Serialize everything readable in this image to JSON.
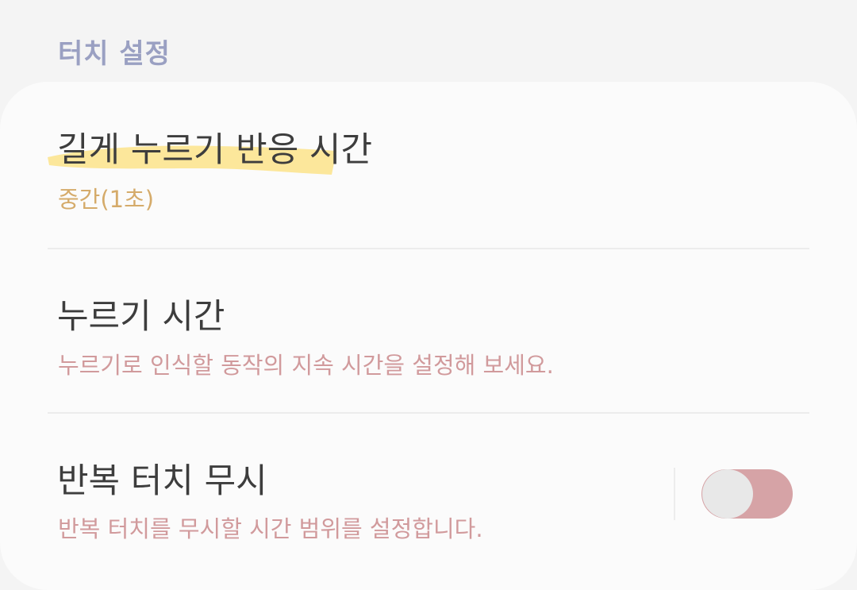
{
  "section": {
    "title": "터치 설정"
  },
  "items": [
    {
      "title": "길게 누르기 반응 시간",
      "subtitle": "중간(1초)"
    },
    {
      "title": "누르기 시간",
      "subtitle": "누르기로 인식할 동작의 지속 시간을 설정해 보세요."
    },
    {
      "title": "반복 터치 무시",
      "subtitle": "반복 터치를 무시할 시간 범위를 설정합니다.",
      "toggle_on": false
    }
  ],
  "colors": {
    "section_header": "#9aa0c2",
    "title_text": "#3d3d3d",
    "value_text": "#d5ab6a",
    "description_text": "#d19a9c",
    "highlight": "#fce38a",
    "toggle_track": "#d6a3a6",
    "toggle_knob": "#e8e8e8"
  }
}
